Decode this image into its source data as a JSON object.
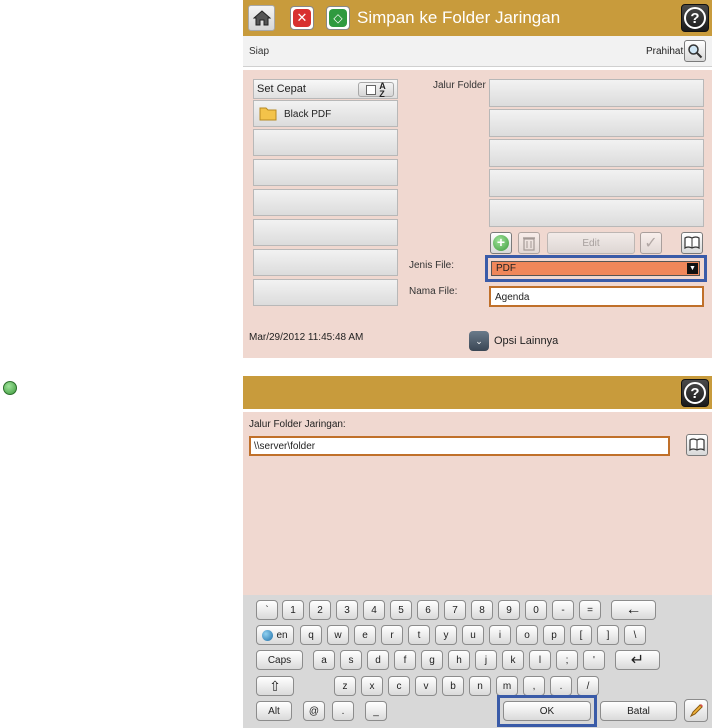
{
  "top": {
    "title": "Simpan ke Folder Jaringan",
    "status": "Siap",
    "preview_label": "Prahihat",
    "quick_sets": {
      "label": "Set Cepat",
      "sort_icon": "sort-az-icon",
      "items": [
        "Black PDF",
        "",
        "",
        "",
        "",
        "",
        "",
        ""
      ]
    },
    "folder_path_label": "Jalur Folder",
    "folder_actions": {
      "add_icon": "plus-icon",
      "delete_icon": "trash-icon",
      "edit_label": "Edit",
      "check_icon": "check-icon",
      "book_icon": "address-book-icon"
    },
    "file_type_label": "Jenis File:",
    "file_type_value": "PDF",
    "file_name_label": "Nama File:",
    "file_name_value": "Agenda",
    "datetime": "Mar/29/2012 11:45:48 AM",
    "more_options": "Opsi Lainnya"
  },
  "bottom": {
    "path_label": "Jalur Folder Jaringan:",
    "path_value": "\\\\server\\folder",
    "keyboard": {
      "row1": [
        "`",
        "1",
        "2",
        "3",
        "4",
        "5",
        "6",
        "7",
        "8",
        "9",
        "0",
        "-",
        "=",
        "←"
      ],
      "row2": [
        "en",
        "q",
        "w",
        "e",
        "r",
        "t",
        "y",
        "u",
        "i",
        "o",
        "p",
        "[",
        "]",
        "\\"
      ],
      "row3": [
        "Caps",
        "a",
        "s",
        "d",
        "f",
        "g",
        "h",
        "j",
        "k",
        "l",
        ";",
        "'",
        "↵"
      ],
      "row4": [
        "⇧",
        "z",
        "x",
        "c",
        "v",
        "b",
        "n",
        "m",
        ",",
        ".",
        "/"
      ],
      "row5": [
        "Alt",
        "@",
        ".",
        "_",
        "OK",
        "Batal"
      ]
    }
  },
  "colors": {
    "titlebar": "#c89b3c",
    "pane": "#f0d8d0",
    "file_type_orange": "#f0875a",
    "highlight_blue": "#3a5ba8",
    "highlight_orange": "#c0702a"
  }
}
